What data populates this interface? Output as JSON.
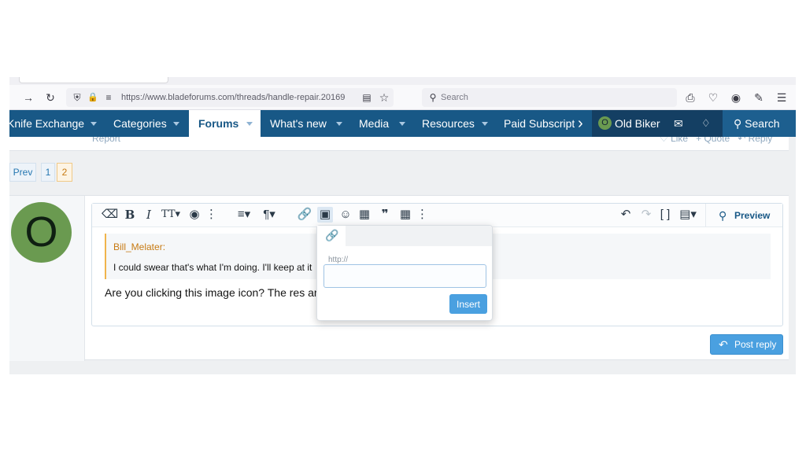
{
  "browser": {
    "url": "https://www.bladeforums.com/threads/handle-repair.20169",
    "search_placeholder": "Search"
  },
  "nav": {
    "items": [
      {
        "label": "Knife Exchange"
      },
      {
        "label": "Categories"
      },
      {
        "label": "Forums"
      },
      {
        "label": "What's new"
      },
      {
        "label": "Media"
      },
      {
        "label": "Resources"
      },
      {
        "label": "Paid Subscript"
      }
    ],
    "user_initial": "O",
    "user_name": "Old Biker",
    "search_label": "Search"
  },
  "post_actions": {
    "report": "Report",
    "like": "Like",
    "quote": "Quote",
    "reply": "Reply"
  },
  "pagination": {
    "prev": "Prev",
    "pages": [
      "1",
      "2"
    ],
    "current_page": "2"
  },
  "reply": {
    "avatar_initial": "O",
    "quote_author": "Bill_Melater:",
    "quote_text": "I could swear that's what I'm doing.  I'll keep at it",
    "typed_text": "Are you clicking this image icon? The res are fine",
    "preview_label": "Preview",
    "post_reply_label": "Post reply"
  },
  "image_popup": {
    "field_label": "http://",
    "input_value": "",
    "insert_label": "Insert"
  },
  "colors": {
    "nav_bg": "#185886",
    "accent": "#4aa0e0",
    "quote_border": "#f0b44c",
    "avatar_green": "#6a9a50"
  }
}
